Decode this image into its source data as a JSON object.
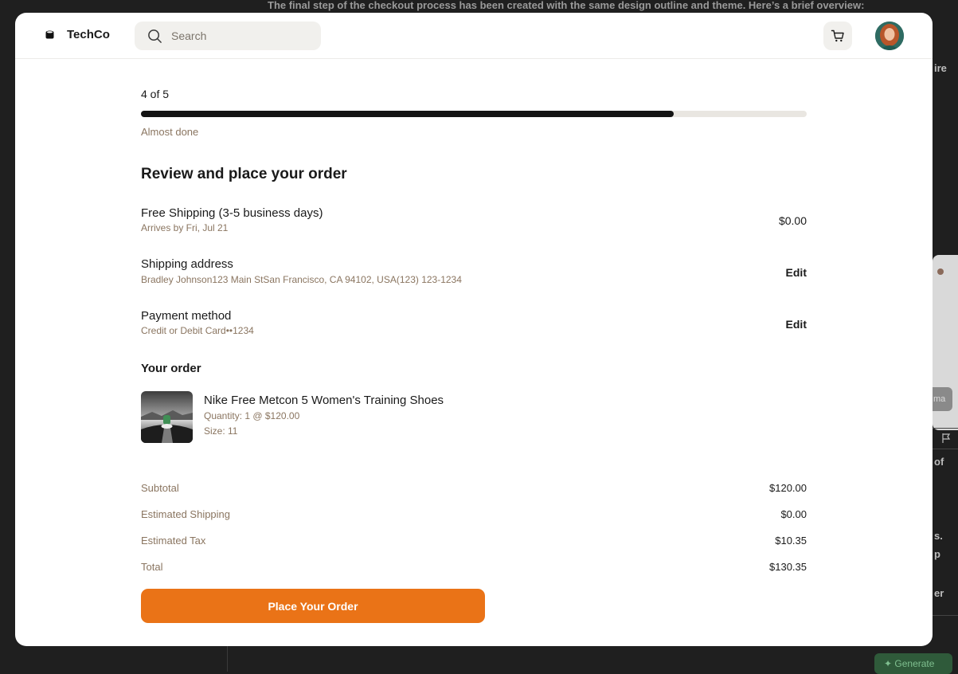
{
  "background": {
    "top_text": "The final step of the checkout process has been created with the same design outline and theme. Here’s a brief overview:",
    "right_fragments": [
      "ire",
      "ma",
      "of",
      "s.",
      "p",
      "er"
    ],
    "generate_label": "Generate"
  },
  "header": {
    "brand_name": "TechCo",
    "search_placeholder": "Search"
  },
  "progress": {
    "step_text": "4 of 5",
    "value": 0.8,
    "note": "Almost done"
  },
  "review": {
    "title": "Review and place your order",
    "shipping": {
      "title": "Free Shipping (3-5 business days)",
      "subtitle": "Arrives by Fri, Jul 21",
      "price": "$0.00"
    },
    "address": {
      "title": "Shipping address",
      "subtitle": "Bradley Johnson123 Main StSan Francisco, CA 94102, USA(123) 123-1234",
      "edit_label": "Edit"
    },
    "payment": {
      "title": "Payment method",
      "subtitle": "Credit or Debit Card••1234",
      "edit_label": "Edit"
    }
  },
  "order": {
    "heading": "Your order",
    "product": {
      "name": "Nike Free Metcon 5 Women's Training Shoes",
      "quantity_text": "Quantity: 1 @ $120.00",
      "size_text": "Size: 11"
    }
  },
  "summary": [
    {
      "label": "Subtotal",
      "value": "$120.00"
    },
    {
      "label": "Estimated Shipping",
      "value": "$0.00"
    },
    {
      "label": "Estimated Tax",
      "value": "$10.35"
    },
    {
      "label": "Total",
      "value": "$130.35"
    }
  ],
  "cta": {
    "label": "Place Your Order",
    "color": "#ea7317"
  },
  "colors": {
    "accent": "#ea7317",
    "muted_text": "#8a7560",
    "progress_fill": "#141414"
  }
}
